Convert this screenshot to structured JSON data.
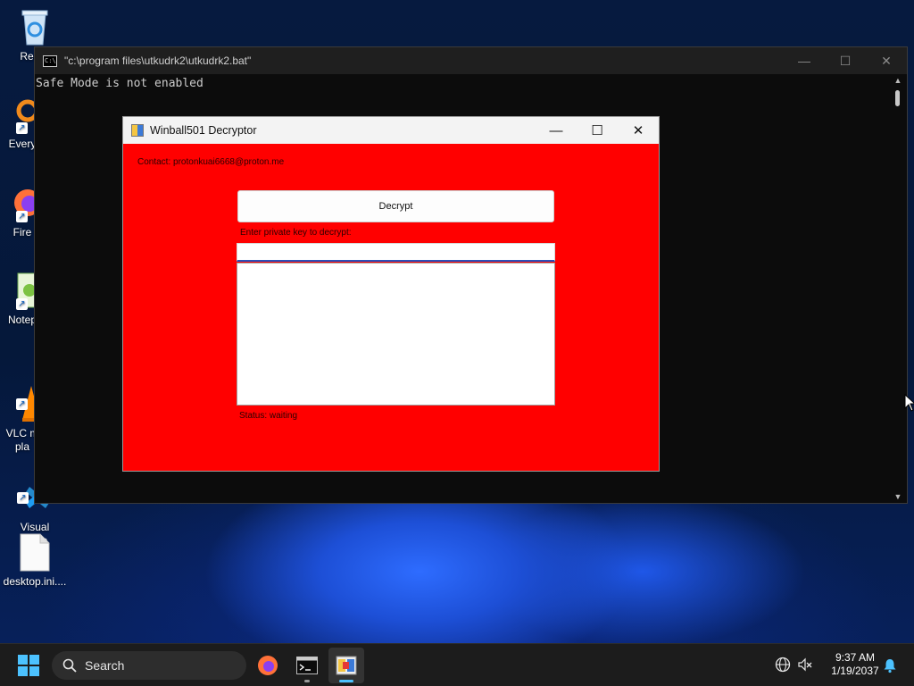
{
  "desktop": {
    "icons": [
      {
        "label": "Recyc",
        "icon": "recycle-bin-icon"
      },
      {
        "label": "Every",
        "icon": "everything-icon"
      },
      {
        "label": "Fire",
        "icon": "firefox-icon"
      },
      {
        "label": "Notep",
        "icon": "notepad-plus-plus-icon"
      },
      {
        "label": "VLC m\npla",
        "icon": "vlc-icon"
      },
      {
        "label": "Visual\nCode",
        "icon": "vscode-icon"
      },
      {
        "label": "desktop.ini....",
        "icon": "file-icon"
      }
    ]
  },
  "cmd_window": {
    "title": "\"c:\\program files\\utkudrk2\\utkudrk2.bat\"",
    "console_text": "Safe Mode is not enabled",
    "buttons": {
      "minimize": "—",
      "maximize": "☐",
      "close": "✕"
    }
  },
  "decryptor_window": {
    "title": "Winball501 Decryptor",
    "contact_text": "Contact: protonkuai6668@proton.me",
    "decrypt_button_label": "Decrypt",
    "key_prompt": "Enter private key to decrypt:",
    "key_value": "",
    "status_text": "Status: waiting",
    "buttons": {
      "minimize": "—",
      "maximize": "☐",
      "close": "✕"
    },
    "background_color": "#ff0000"
  },
  "taskbar": {
    "search_placeholder": "Search",
    "apps": [
      {
        "name": "Firefox",
        "icon": "firefox-icon",
        "active": false
      },
      {
        "name": "Command Prompt",
        "icon": "terminal-icon",
        "active": false
      },
      {
        "name": "Winball501 Decryptor",
        "icon": "decryptor-app-icon",
        "active": true
      }
    ],
    "clock": {
      "time": "9:37 AM",
      "date": "1/19/2037"
    }
  }
}
